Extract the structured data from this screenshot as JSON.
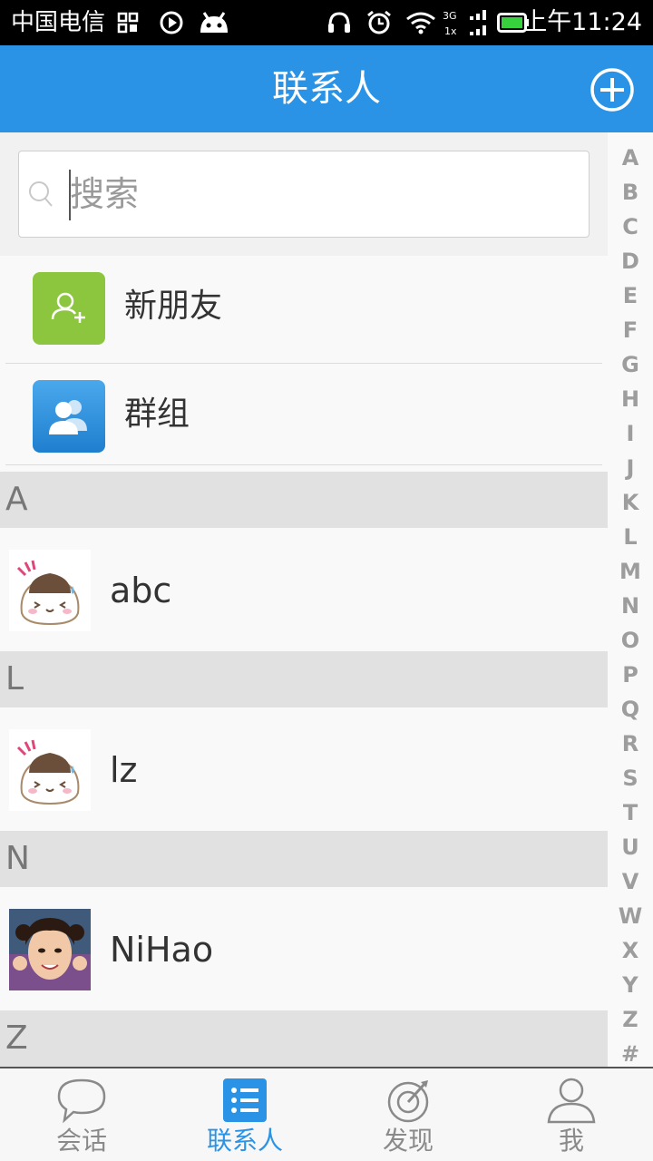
{
  "status_bar": {
    "carrier": "中国电信",
    "time": "上午11:24",
    "signal_label_top": "3G",
    "signal_label_bottom": "1x"
  },
  "header": {
    "title": "联系人",
    "add_icon": "plus-circle-icon"
  },
  "search": {
    "placeholder": "搜索",
    "value": ""
  },
  "special_rows": [
    {
      "label": "新朋友",
      "icon": "add-friend-icon",
      "color": "#8cc63e"
    },
    {
      "label": "群组",
      "icon": "group-icon",
      "color": "#2f8fdb"
    }
  ],
  "sections": [
    {
      "letter": "A",
      "contacts": [
        {
          "name": "abc",
          "avatar": "rice-ball-avatar"
        }
      ]
    },
    {
      "letter": "L",
      "contacts": [
        {
          "name": "lz",
          "avatar": "rice-ball-avatar"
        }
      ]
    },
    {
      "letter": "N",
      "contacts": [
        {
          "name": "NiHao",
          "avatar": "photo-avatar"
        }
      ]
    },
    {
      "letter": "Z",
      "contacts": []
    }
  ],
  "alphabet": [
    "A",
    "B",
    "C",
    "D",
    "E",
    "F",
    "G",
    "H",
    "I",
    "J",
    "K",
    "L",
    "M",
    "N",
    "O",
    "P",
    "Q",
    "R",
    "S",
    "T",
    "U",
    "V",
    "W",
    "X",
    "Y",
    "Z",
    "#"
  ],
  "tabs": [
    {
      "label": "会话",
      "icon": "chat-bubble-icon",
      "active": false
    },
    {
      "label": "联系人",
      "icon": "contacts-list-icon",
      "active": true
    },
    {
      "label": "发现",
      "icon": "discover-radar-icon",
      "active": false
    },
    {
      "label": "我",
      "icon": "person-icon",
      "active": false
    }
  ],
  "colors": {
    "accent": "#2a93e6",
    "section_bg": "#e1e1e1",
    "index_text": "#9d9d9d"
  }
}
